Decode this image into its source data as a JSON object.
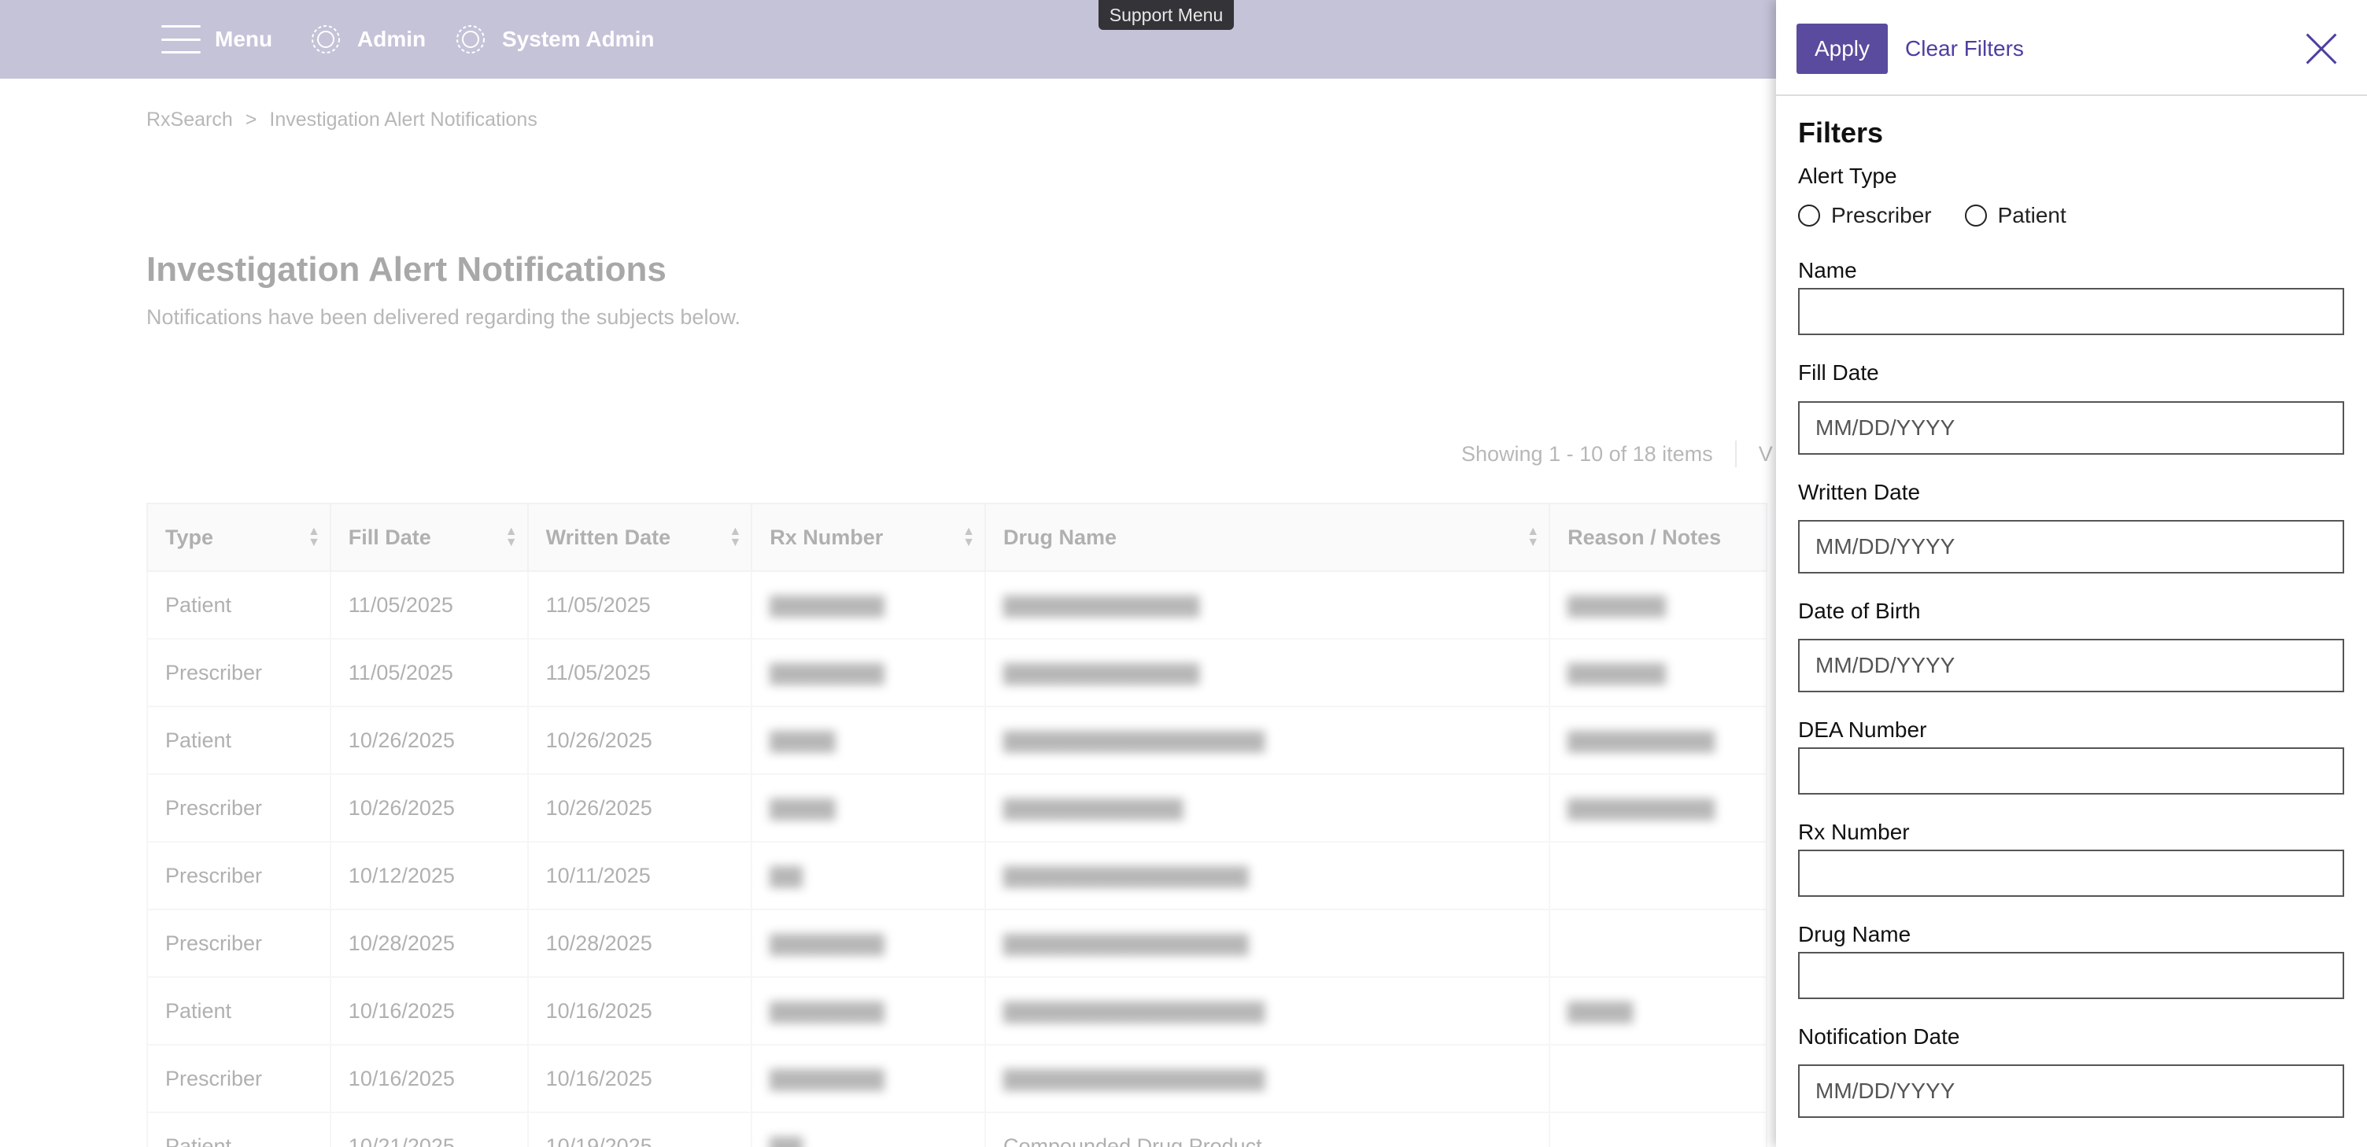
{
  "nav": {
    "menu_label": "Menu",
    "admin_label": "Admin",
    "system_admin_label": "System Admin",
    "support_menu_label": "Support Menu"
  },
  "breadcrumb": {
    "root": "RxSearch",
    "separator": ">",
    "current": "Investigation Alert Notifications"
  },
  "page": {
    "title": "Investigation Alert Notifications",
    "subtitle": "Notifications have been delivered regarding the subjects below.",
    "pager_text": "Showing 1 - 10 of 18 items",
    "pager_extra": "V"
  },
  "table": {
    "headers": [
      "Type",
      "Fill Date",
      "Written Date",
      "Rx Number",
      "Drug Name",
      "Reason / Notes"
    ],
    "rows": [
      [
        "Patient",
        "11/05/2025",
        "11/05/2025",
        "",
        "",
        ""
      ],
      [
        "Prescriber",
        "11/05/2025",
        "11/05/2025",
        "",
        "",
        ""
      ],
      [
        "Patient",
        "10/26/2025",
        "10/26/2025",
        "",
        "",
        ""
      ],
      [
        "Prescriber",
        "10/26/2025",
        "10/26/2025",
        "",
        "",
        ""
      ],
      [
        "Prescriber",
        "10/12/2025",
        "10/11/2025",
        "",
        "",
        ""
      ],
      [
        "Prescriber",
        "10/28/2025",
        "10/28/2025",
        "",
        "",
        ""
      ],
      [
        "Patient",
        "10/16/2025",
        "10/16/2025",
        "",
        "",
        ""
      ],
      [
        "Prescriber",
        "10/16/2025",
        "10/16/2025",
        "",
        "",
        ""
      ],
      [
        "Patient",
        "10/21/2025",
        "10/19/2025",
        "",
        "Compounded Drug Product",
        ""
      ]
    ]
  },
  "drawer": {
    "apply_label": "Apply",
    "clear_label": "Clear Filters",
    "title": "Filters",
    "alert_type_label": "Alert Type",
    "alert_type_options": [
      "Prescriber",
      "Patient"
    ],
    "name_label": "Name",
    "name_value": "",
    "fill_date_label": "Fill Date",
    "written_date_label": "Written Date",
    "dob_label": "Date of Birth",
    "dea_label": "DEA Number",
    "rx_label": "Rx Number",
    "drug_label": "Drug Name",
    "notification_date_label": "Notification Date",
    "date_placeholder": "MM/DD/YYYY"
  },
  "colors": {
    "nav_bg": "#c5c3d8",
    "accent": "#5a4b9e",
    "link": "#4c3fa0"
  }
}
